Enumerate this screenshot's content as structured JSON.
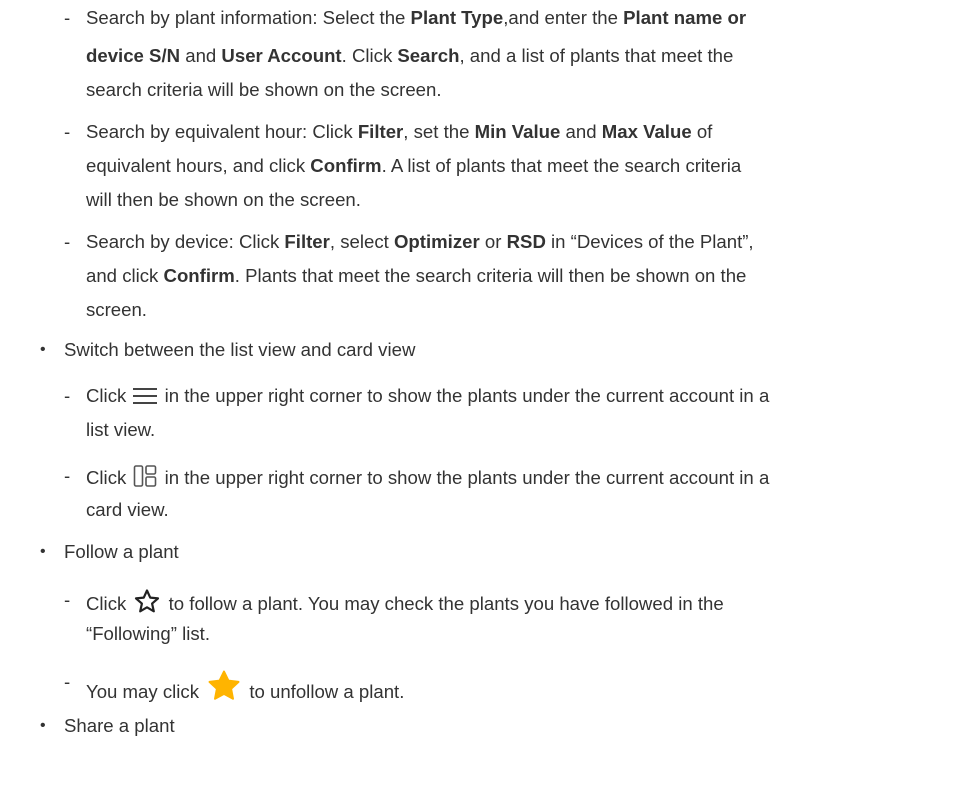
{
  "sub_a": {
    "dash": "-",
    "p1": "Search by plant information: Select the ",
    "b1": "Plant Type",
    "p2": ",and enter the ",
    "b2": "Plant name or",
    "b3": "device S/N",
    "p3": " and ",
    "b4": "User Account",
    "p4": ". Click ",
    "b5": "Search",
    "p5": ", and a list of plants that meet the",
    "p6": "search criteria will be shown on the screen."
  },
  "sub_b": {
    "dash": "-",
    "p1": "Search by equivalent hour: Click ",
    "b1": "Filter",
    "p2": ", set the ",
    "b2": "Min Value",
    "p3": " and ",
    "b3": "Max Value",
    "p4": " of",
    "p5": "equivalent hours, and click ",
    "b4": "Confirm",
    "p6": ". A list of plants that meet the search criteria",
    "p7": "will then be shown on the screen."
  },
  "sub_c": {
    "dash": "-",
    "p1": "Search by device: Click ",
    "b1": "Filter",
    "p2": ", select ",
    "b2": "Optimizer",
    "p3": " or ",
    "b3": "RSD",
    "p4": " in “Devices of the Plant”,",
    "p5": "and click ",
    "b4": "Confirm",
    "p6": ". Plants that meet the search criteria will then be shown on the",
    "p7": "screen."
  },
  "bullets": {
    "symbol": "•",
    "switch_view": "Switch between the list view and card view",
    "follow": "Follow a plant",
    "share": "Share a plant"
  },
  "list_view": {
    "dash": "-",
    "p1": "Click ",
    "icon": "list-view-icon",
    "p2": " in the upper right corner to show the plants under the current account in a",
    "p3": "list view."
  },
  "card_view": {
    "dash": "-",
    "p1": "Click ",
    "icon": "card-view-icon",
    "p2": " in the upper right corner to show the plants under the current account in a",
    "p3": "card view."
  },
  "follow_item": {
    "dash": "-",
    "p1": "Click ",
    "icon": "star-outline-icon",
    "p2": " to follow a plant. You may check the plants you have followed in the",
    "p3": "“Following” list."
  },
  "unfollow_item": {
    "dash": "-",
    "p1": "You may click ",
    "icon": "star-filled-icon",
    "p2": " to unfollow a plant."
  },
  "colors": {
    "text": "#333333",
    "star_filled": "#FFB400",
    "icon_stroke": "#555555"
  }
}
